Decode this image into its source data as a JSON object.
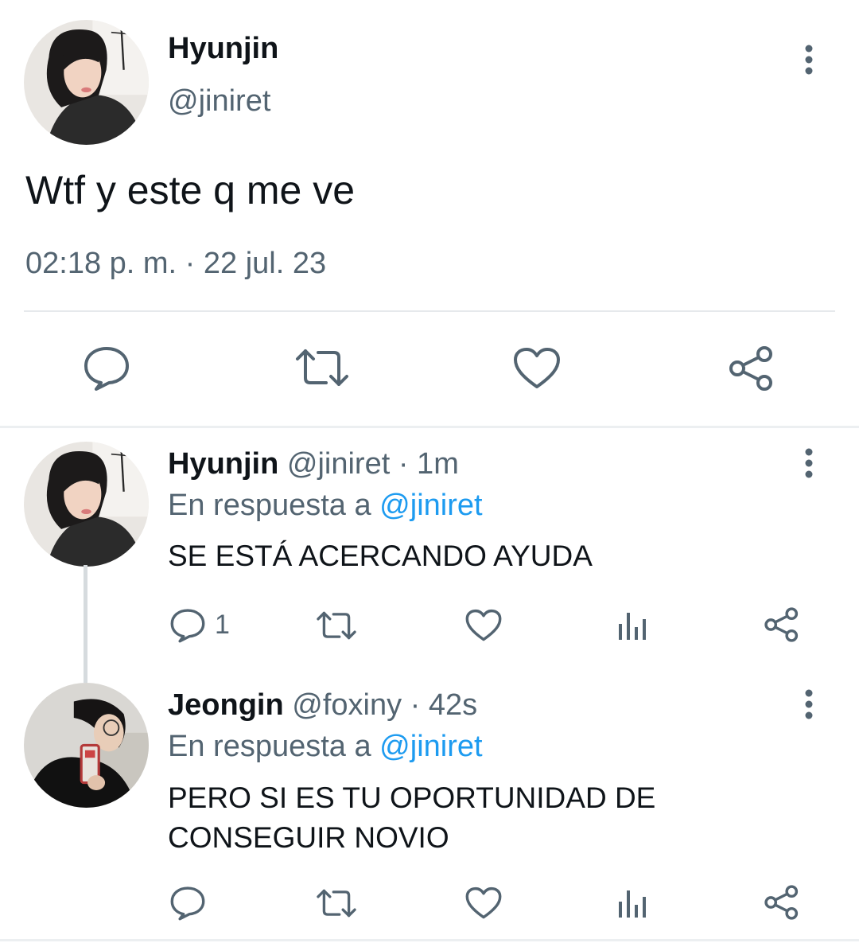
{
  "main_tweet": {
    "author_name": "Hyunjin",
    "author_handle": "@jiniret",
    "text": "Wtf y este q me ve",
    "timestamp": "02:18 p. m. · 22 jul. 23",
    "actions": [
      "reply-icon",
      "retweet-icon",
      "like-icon",
      "share-icon"
    ]
  },
  "replies": [
    {
      "author_name": "Hyunjin",
      "author_handle": "@jiniret",
      "time": "· 1m",
      "replying_prefix": "En respuesta a",
      "replying_to": "@jiniret",
      "text": "SE ESTÁ ACERCANDO AYUDA",
      "reply_count": "1",
      "actions": [
        "reply-icon",
        "retweet-icon",
        "like-icon",
        "views-icon",
        "share-icon"
      ]
    },
    {
      "author_name": "Jeongin",
      "author_handle": "@foxiny",
      "time": "· 42s",
      "replying_prefix": "En respuesta a",
      "replying_to": "@jiniret",
      "text_line1": "PERO SI ES TU OPORTUNIDAD DE",
      "text_line2": "CONSEGUIR NOVIO",
      "actions": [
        "reply-icon",
        "retweet-icon",
        "like-icon",
        "views-icon",
        "share-icon"
      ]
    }
  ],
  "colors": {
    "text_primary": "#0f1419",
    "text_secondary": "#536471",
    "link": "#1d9bf0",
    "icon": "#536471",
    "divider": "#e6e9ec"
  }
}
